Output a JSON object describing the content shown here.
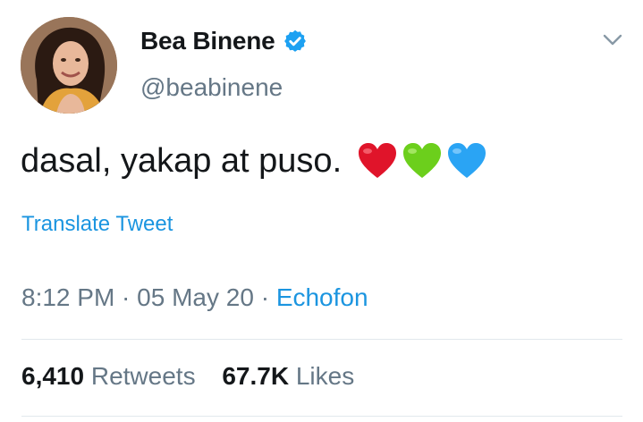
{
  "user": {
    "display_name": "Bea Binene",
    "handle": "@beabinene",
    "verified": true
  },
  "tweet": {
    "text": "dasal, yakap at puso.",
    "emoji": [
      "red-heart",
      "green-heart",
      "blue-heart"
    ],
    "translate_label": "Translate Tweet"
  },
  "meta": {
    "time": "8:12 PM",
    "sep1": " · ",
    "date": "05 May 20",
    "sep2": " · ",
    "source": "Echofon"
  },
  "stats": {
    "retweets_count": "6,410",
    "retweets_label": "Retweets",
    "likes_count": "67.7K",
    "likes_label": "Likes"
  },
  "colors": {
    "text": "#14171a",
    "secondary": "#657786",
    "link": "#1b95e0",
    "verified": "#1da1f2",
    "divider": "#e1e8ed",
    "heart_red": "#e0142a",
    "heart_green": "#6ccf1c",
    "heart_blue": "#2aa4f4"
  }
}
